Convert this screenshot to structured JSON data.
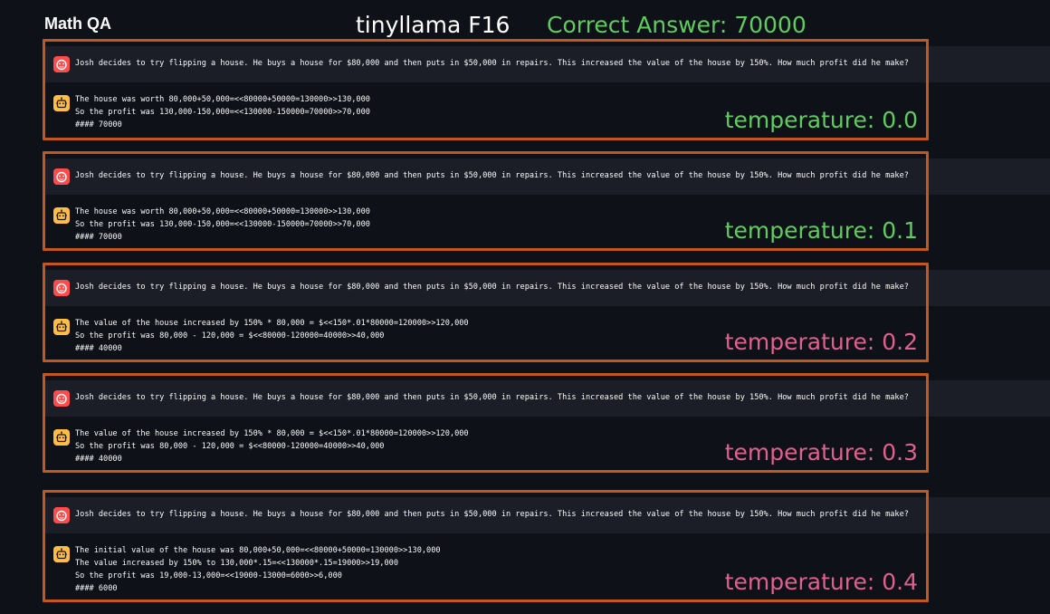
{
  "header": {
    "app_title": "Math QA",
    "model_label": "tinyllama F16",
    "correct_answer_label": "Correct Answer: 70000"
  },
  "colors": {
    "background": "#0e1117",
    "frame": "#c2581e",
    "correct": "#5fcc5f",
    "incorrect": "#e0608e",
    "user_avatar": "#ff4b4b",
    "assistant_avatar": "#ffbd45"
  },
  "icons": {
    "user_avatar": "user-avatar-icon",
    "assistant_avatar": "assistant-avatar-icon"
  },
  "runs": [
    {
      "question": "Josh decides to try flipping a house. He buys a house for $80,000 and then puts in $50,000 in repairs. This increased the value of the house by 150%. How much profit did he make?",
      "answer_lines": [
        "The house was worth 80,000+50,000=<<80000+50000=130000>>130,000",
        "So the profit was 130,000-150,000=<<130000-150000=70000>>70,000",
        "#### 70000"
      ],
      "temperature_label": "temperature: 0.0",
      "correct": true
    },
    {
      "question": "Josh decides to try flipping a house. He buys a house for $80,000 and then puts in $50,000 in repairs. This increased the value of the house by 150%. How much profit did he make?",
      "answer_lines": [
        "The house was worth 80,000+50,000=<<80000+50000=130000>>130,000",
        "So the profit was 130,000-150,000=<<130000-150000=70000>>70,000",
        "#### 70000"
      ],
      "temperature_label": "temperature: 0.1",
      "correct": true
    },
    {
      "question": "Josh decides to try flipping a house. He buys a house for $80,000 and then puts in $50,000 in repairs. This increased the value of the house by 150%. How much profit did he make?",
      "answer_lines": [
        "The value of the house increased by 150% * 80,000 = $<<150*.01*80000=120000>>120,000",
        "So the profit was 80,000 - 120,000 = $<<80000-120000=40000>>40,000",
        "#### 40000"
      ],
      "temperature_label": "temperature: 0.2",
      "correct": false
    },
    {
      "question": "Josh decides to try flipping a house. He buys a house for $80,000 and then puts in $50,000 in repairs. This increased the value of the house by 150%. How much profit did he make?",
      "answer_lines": [
        "The value of the house increased by 150% * 80,000 = $<<150*.01*80000=120000>>120,000",
        "So the profit was 80,000 - 120,000 = $<<80000-120000=40000>>40,000",
        "#### 40000"
      ],
      "temperature_label": "temperature: 0.3",
      "correct": false
    },
    {
      "question": "Josh decides to try flipping a house. He buys a house for $80,000 and then puts in $50,000 in repairs. This increased the value of the house by 150%. How much profit did he make?",
      "answer_lines": [
        "The initial value of the house was 80,000+50,000=<<80000+50000=130000>>130,000",
        "The value increased by 150% to 130,000*.15=<<130000*.15=19000>>19,000",
        "So the profit was 19,000-13,000=<<19000-13000=6000>>6,000",
        "#### 6000"
      ],
      "temperature_label": "temperature: 0.4",
      "correct": false
    }
  ]
}
